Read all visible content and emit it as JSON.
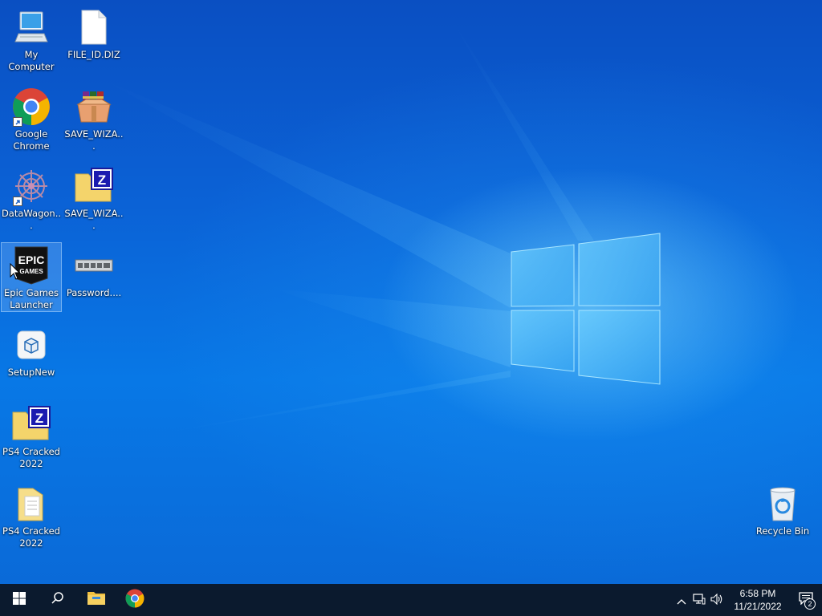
{
  "desktop": {
    "icons": [
      {
        "label": "My Computer",
        "icon": "computer-icon"
      },
      {
        "label": "FILE_ID.DIZ",
        "icon": "document-icon"
      },
      {
        "label": "Google Chrome",
        "icon": "chrome-icon"
      },
      {
        "label": "SAVE_WIZA...",
        "icon": "winrar-icon"
      },
      {
        "label": "DataWagon...",
        "icon": "datawagon-icon"
      },
      {
        "label": "SAVE_WIZA...",
        "icon": "zip-folder-icon"
      },
      {
        "label": "Epic Games Launcher",
        "icon": "epic-games-icon"
      },
      {
        "label": "Password....",
        "icon": "password-file-icon"
      },
      {
        "label": "SetupNew",
        "icon": "setup-icon"
      },
      {
        "label": "PS4 Cracked 2022",
        "icon": "zip-folder-icon"
      },
      {
        "label": "PS4 Cracked 2022",
        "icon": "folder-icon"
      },
      {
        "label": "Recycle Bin",
        "icon": "recycle-bin-icon"
      }
    ],
    "epic_icon_text": [
      "EPIC",
      "GAMES"
    ],
    "zip_badge": "Z"
  },
  "taskbar": {
    "start": "windows-start-icon",
    "search": "search-icon",
    "pinned": [
      "file-explorer-icon",
      "chrome-icon"
    ],
    "tray": [
      "chevron-up-icon",
      "network-icon",
      "volume-icon"
    ],
    "time": "6:58 PM",
    "date": "11/21/2022",
    "notification_count": "2"
  },
  "colors": {
    "taskbar": "#0b1a2e",
    "wallpaper_blue": "#0a6ad8",
    "folder_yellow": "#f4d46b",
    "chrome_red": "#db4437",
    "chrome_yellow": "#f4b400",
    "chrome_green": "#0f9d58",
    "chrome_blue": "#4285f4"
  }
}
